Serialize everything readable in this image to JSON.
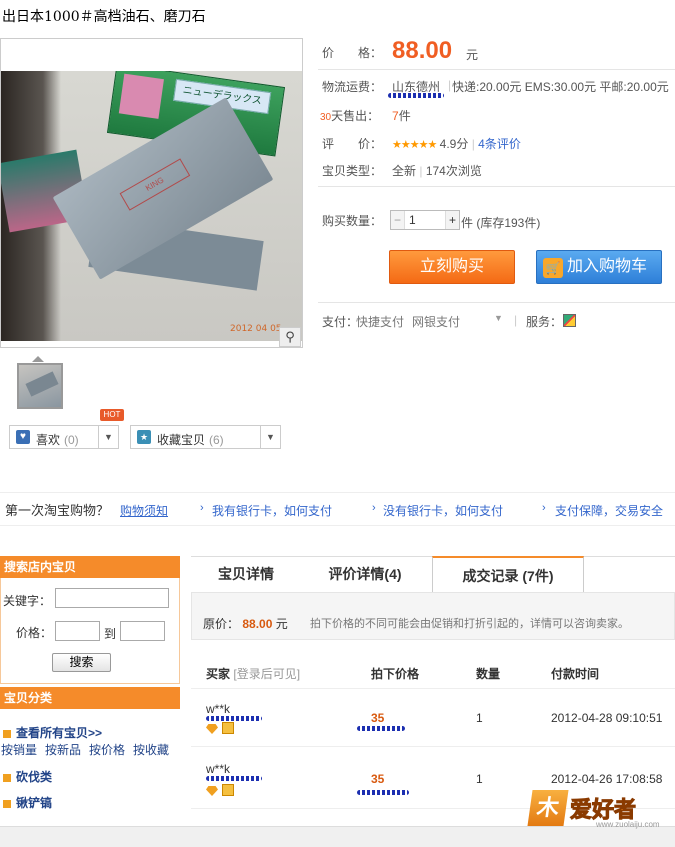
{
  "product": {
    "title": "出日本1000＃高档油石、磨刀石",
    "photo_date": "2012 04 05",
    "photo_box_text": "ニューデラックス 1000",
    "photo_stamp_text": "KING"
  },
  "info": {
    "price_label": "价　　格：",
    "price_value": "88.00",
    "price_unit": "元",
    "shipping_label": "物流运费：",
    "shipping_origin": "山东德州",
    "shipping_detail": "快递:20.00元 EMS:30.00元 平邮:20.00元",
    "sold_prefix": "30",
    "sold_label": "天售出：",
    "sold_value": "7",
    "sold_unit": "件",
    "rating_label": "评　　价：",
    "rating_stars": "★★★★★",
    "rating_score": "4.9分",
    "rating_count": "4条评价",
    "type_label": "宝贝类型：",
    "type_value": "全新",
    "type_views": "174次浏览",
    "qty_label": "购买数量：",
    "qty_value": "1",
    "qty_stock": "件 (库存193件)",
    "buy_now": "立刻购买",
    "add_cart": "加入购物车",
    "pay_label": "支付：",
    "pay_methods": [
      "快捷支付",
      "网银支付"
    ],
    "service_label": "服务："
  },
  "social": {
    "like_label": "喜欢",
    "like_count": "(0)",
    "fav_label": "收藏宝贝",
    "fav_count": "(6)",
    "hot_badge": "HOT"
  },
  "help": {
    "question": "第一次淘宝购物？",
    "guide": "购物须知",
    "links": [
      "我有银行卡，如何支付",
      "没有银行卡，如何支付",
      "支付保障，交易安全"
    ]
  },
  "sidebar": {
    "search_title": "搜索店内宝贝",
    "keyword_label": "关键字：",
    "price_label": "价格：",
    "price_to": "到",
    "search_button": "搜索",
    "category_title": "宝贝分类",
    "view_all": "查看所有宝贝>>",
    "sorts": [
      "按销量",
      "按新品",
      "按价格",
      "按收藏"
    ],
    "categories": [
      "砍伐类",
      "锹铲镐"
    ]
  },
  "tabs": [
    {
      "label": "宝贝详情"
    },
    {
      "label": "评价详情(4)"
    },
    {
      "label": "成交记录 (7件)"
    }
  ],
  "records": {
    "orig_label": "原价：",
    "orig_price": "88.00",
    "orig_unit": "元",
    "note": "拍下价格的不同可能会由促销和打折引起的，详情可以咨询卖家。",
    "headers": {
      "buyer": "买家",
      "buyer_hint": "[登录后可见]",
      "price": "拍下价格",
      "qty": "数量",
      "time": "付款时间"
    },
    "rows": [
      {
        "buyer": "w**k",
        "price": "35",
        "qty": "1",
        "time": "2012-04-28 09:10:51"
      },
      {
        "buyer": "w**k",
        "price": "35",
        "qty": "1",
        "time": "2012-04-26 17:08:58"
      }
    ]
  },
  "watermark": {
    "word": "爱好者",
    "url": "www.zuolaiju.com"
  },
  "colors": {
    "accent": "#f58b2a",
    "price": "#f05e23",
    "link": "#3366cc",
    "cart": "#2e7fd8"
  }
}
